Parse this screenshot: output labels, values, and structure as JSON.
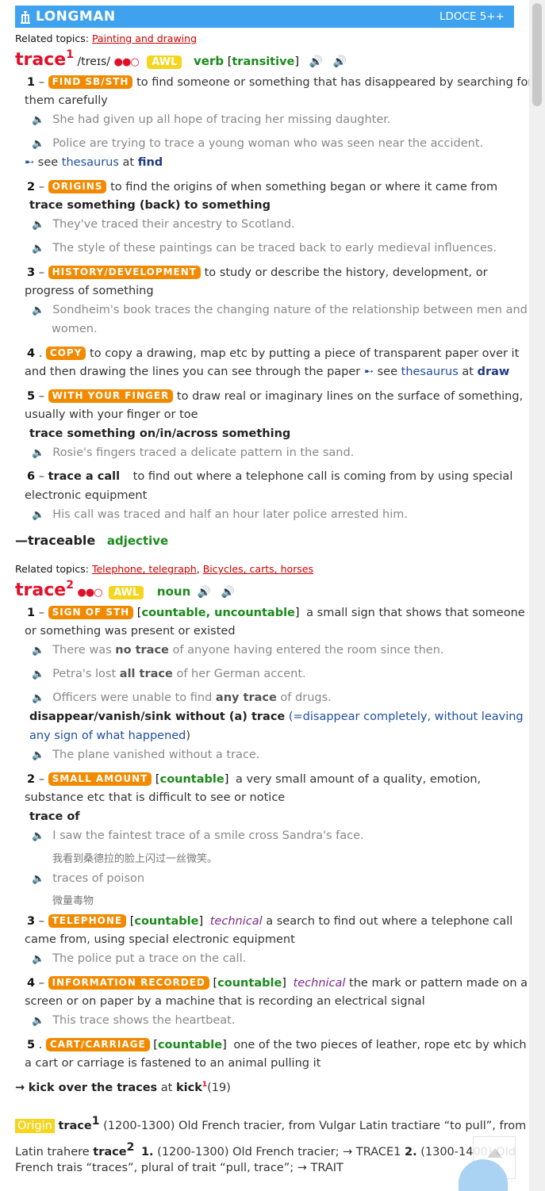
{
  "header": {
    "brand": "LONGMAN",
    "edition": "LDOCE 5++"
  },
  "entry1": {
    "related_label": "Related topics:",
    "related_link": "Painting and drawing",
    "headword": "trace",
    "hom": "1",
    "pron": "/treɪs/",
    "freq": "●●○",
    "awl": "AWL",
    "pos": "verb",
    "gram_open": "[",
    "gram": "transitive",
    "gram_close": "]",
    "senses": {
      "s1": {
        "num": "1",
        "sign": "FIND SB/STH",
        "def_a": "to find someone or something that has disappeared by searching for",
        "def_b": "them carefully",
        "ex1": "She had given up all hope of tracing her missing daughter.",
        "ex2": "Police are trying to trace a young woman who was seen near the accident.",
        "see": "see",
        "thes": "thesaurus",
        "at": "at",
        "target": "find"
      },
      "s2": {
        "num": "2",
        "sign": "ORIGINS",
        "def": "to find the origins of when something began or where it came from",
        "pattern": "trace something (back) to something",
        "ex1": "They've traced their ancestry to Scotland.",
        "ex2": "The style of these paintings can be traced back to early medieval influences."
      },
      "s3": {
        "num": "3",
        "sign": "HISTORY/DEVELOPMENT",
        "def_a": "to study or describe the history, development, or",
        "def_b": "progress of something",
        "ex1a": "Sondheim's book traces the changing nature of the relationship between men and",
        "ex1b": "women."
      },
      "s4": {
        "num": "4",
        "sign": "COPY",
        "def_a": "to copy a drawing, map etc by putting a piece of transparent paper over it",
        "def_b": "and then drawing the lines you can see through the paper",
        "see": "see",
        "thes": "thesaurus",
        "at": "at",
        "target": "draw"
      },
      "s5": {
        "num": "5",
        "sign": "WITH YOUR FINGER",
        "def_a": "to draw real or imaginary lines on the surface of something,",
        "def_b": "usually with your finger or toe",
        "pattern": "trace something on/in/across something",
        "ex1": "Rosie's fingers traced a delicate pattern in the sand."
      },
      "s6": {
        "num": "6",
        "phrase": "trace a call",
        "def_a": "to find out where a telephone call is coming from by using special",
        "def_b": "electronic equipment",
        "ex1": "His call was traced and half an hour later police arrested him."
      }
    },
    "derived": "traceable",
    "derived_pos": "adjective"
  },
  "entry2": {
    "related_label": "Related topics:",
    "related_links": [
      "Telephone, telegraph",
      "Bicycles, carts, horses"
    ],
    "headword": "trace",
    "hom": "2",
    "freq": "●●○",
    "awl": "AWL",
    "pos": "noun",
    "senses": {
      "s1": {
        "num": "1",
        "sign": "SIGN OF STH",
        "gram": "countable, uncountable",
        "def_a": "a small sign that shows that someone",
        "def_b": "or something was present or existed",
        "ex1_a": "There was ",
        "ex1_b": "no trace",
        "ex1_c": " of anyone having entered the room since then.",
        "ex2_a": "Petra's lost ",
        "ex2_b": "all trace",
        "ex2_c": " of her German accent.",
        "ex3_a": "Officers were unable to find ",
        "ex3_b": "any trace",
        "ex3_c": " of drugs.",
        "phr": "disappear/vanish/sink without (a) trace",
        "gloss_a": "(=disappear completely, without leaving",
        "gloss_b": "any sign of what happened",
        "gloss_c": ")",
        "ex4": "The plane vanished without a trace."
      },
      "s2": {
        "num": "2",
        "sign": "SMALL AMOUNT",
        "gram": "countable",
        "def_a": "a very small amount of a quality, emotion,",
        "def_b": "substance etc that is difficult to see or notice",
        "pattern": "trace of",
        "ex1": "I saw the faintest trace of a smile cross Sandra's face.",
        "ex1_tr": "我看到桑德拉的脸上闪过一丝微笑。",
        "ex2": "traces of poison",
        "ex2_tr": "微量毒物"
      },
      "s3": {
        "num": "3",
        "sign": "TELEPHONE",
        "gram": "countable",
        "reg": "technical",
        "def_a": "a search to find out where a telephone call",
        "def_b": "came from, using special electronic equipment",
        "ex1": "The police put a trace on the call."
      },
      "s4": {
        "num": "4",
        "sign": "INFORMATION RECORDED",
        "gram": "countable",
        "reg": "technical",
        "def_a": "the mark or pattern made on a",
        "def_b": "screen or on paper by a machine that is recording an electrical signal",
        "ex1": "This trace shows the heartbeat."
      },
      "s5": {
        "num": "5",
        "sign": "CART/CARRIAGE",
        "gram": "countable",
        "def_a": "one of the two pieces of leather, rope etc by which",
        "def_b": "a cart or carriage is fastened to an animal pulling it"
      }
    },
    "xref_arrow": "→",
    "xref": "kick over the traces",
    "xref_at": "at",
    "xref_target": "kick",
    "xref_sup": "1",
    "xref_num": "(19)"
  },
  "origin": {
    "label": "Origin",
    "l1_word": "trace",
    "l1_sup": "1",
    "l1_text": "(1200-1300) Old French tracier, from Vulgar Latin tractiare “to pull”, from",
    "l2_pre": "Latin trahere",
    "l2_word": "trace",
    "l2_sup": "2",
    "l2_n1": "1.",
    "l2_t1": "(1200-1300) Old French tracier; → TRACE1",
    "l2_n2": "2.",
    "l2_t2": "(1300-1400) Old",
    "l3": "French trais “traces”, plural of trait “pull, trace”; → TRAIT"
  },
  "icons": {
    "speaker": "speaker-icon",
    "see_arrow": "arrow-icon",
    "back_to_top": "back-to-top-icon"
  }
}
